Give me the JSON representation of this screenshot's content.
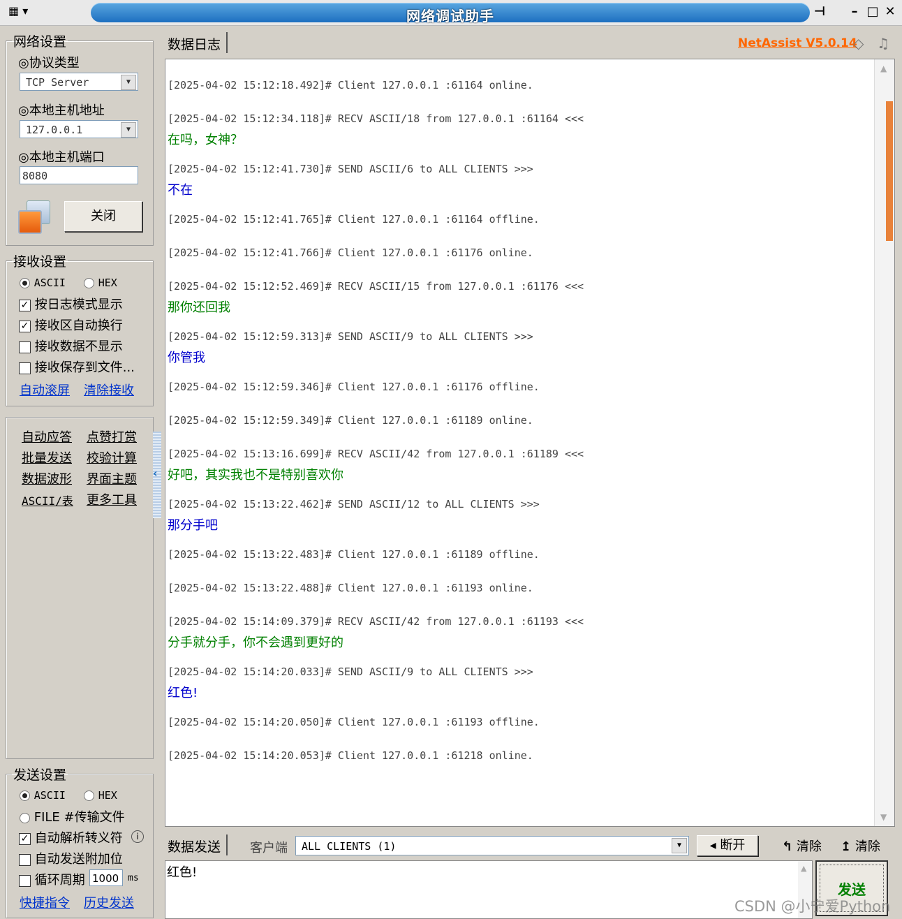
{
  "window": {
    "title": "网络调试助手"
  },
  "network": {
    "legend": "网络设置",
    "protocol_label": "◎协议类型",
    "protocol_value": "TCP Server",
    "host_label": "◎本地主机地址",
    "host_value": "127.0.0.1",
    "port_label": "◎本地主机端口",
    "port_value": "8080",
    "close_button": "关闭"
  },
  "receive": {
    "legend": "接收设置",
    "ascii": "ASCII",
    "hex": "HEX",
    "opt_log_mode": "按日志模式显示",
    "opt_auto_wrap": "接收区自动换行",
    "opt_hide": "接收数据不显示",
    "opt_save_file": "接收保存到文件...",
    "auto_scroll": "自动滚屏",
    "clear_recv": "清除接收"
  },
  "tools": [
    [
      "自动应答",
      "点赞打赏"
    ],
    [
      "批量发送",
      "校验计算"
    ],
    [
      "数据波形",
      "界面主题"
    ],
    [
      "ASCII/表",
      "更多工具"
    ]
  ],
  "send_settings": {
    "legend": "发送设置",
    "ascii": "ASCII",
    "hex": "HEX",
    "file": "FILE #传输文件",
    "opt_escape": "自动解析转义符",
    "opt_append": "自动发送附加位",
    "opt_cycle": "循环周期",
    "cycle_value": "1000",
    "cycle_unit": "ms",
    "shortcuts": "快捷指令",
    "history": "历史发送"
  },
  "log_panel": {
    "tab": "数据日志",
    "brand": "NetAssist V5.0.14",
    "entries": [
      {
        "header": "[2025-04-02 15:12:18.492]# Client 127.0.0.1 :61164 online.",
        "message": "",
        "kind": ""
      },
      {
        "header": "[2025-04-02 15:12:34.118]# RECV ASCII/18 from 127.0.0.1 :61164 <<<",
        "message": "在吗，女神？",
        "kind": "recv"
      },
      {
        "header": "[2025-04-02 15:12:41.730]# SEND ASCII/6 to ALL CLIENTS >>>",
        "message": "不在",
        "kind": "send"
      },
      {
        "header": "[2025-04-02 15:12:41.765]# Client 127.0.0.1 :61164 offline.",
        "message": "",
        "kind": ""
      },
      {
        "header": "[2025-04-02 15:12:41.766]# Client 127.0.0.1 :61176 online.",
        "message": "",
        "kind": ""
      },
      {
        "header": "[2025-04-02 15:12:52.469]# RECV ASCII/15 from 127.0.0.1 :61176 <<<",
        "message": "那你还回我",
        "kind": "recv"
      },
      {
        "header": "[2025-04-02 15:12:59.313]# SEND ASCII/9 to ALL CLIENTS >>>",
        "message": "你管我",
        "kind": "send"
      },
      {
        "header": "[2025-04-02 15:12:59.346]# Client 127.0.0.1 :61176 offline.",
        "message": "",
        "kind": ""
      },
      {
        "header": "[2025-04-02 15:12:59.349]# Client 127.0.0.1 :61189 online.",
        "message": "",
        "kind": ""
      },
      {
        "header": "[2025-04-02 15:13:16.699]# RECV ASCII/42 from 127.0.0.1 :61189 <<<",
        "message": "好吧，其实我也不是特别喜欢你",
        "kind": "recv"
      },
      {
        "header": "[2025-04-02 15:13:22.462]# SEND ASCII/12 to ALL CLIENTS >>>",
        "message": "那分手吧",
        "kind": "send"
      },
      {
        "header": "[2025-04-02 15:13:22.483]# Client 127.0.0.1 :61189 offline.",
        "message": "",
        "kind": ""
      },
      {
        "header": "[2025-04-02 15:13:22.488]# Client 127.0.0.1 :61193 online.",
        "message": "",
        "kind": ""
      },
      {
        "header": "[2025-04-02 15:14:09.379]# RECV ASCII/42 from 127.0.0.1 :61193 <<<",
        "message": "分手就分手，你不会遇到更好的",
        "kind": "recv"
      },
      {
        "header": "[2025-04-02 15:14:20.033]# SEND ASCII/9 to ALL CLIENTS >>>",
        "message": "红色!",
        "kind": "send"
      },
      {
        "header": "[2025-04-02 15:14:20.050]# Client 127.0.0.1 :61193 offline.",
        "message": "",
        "kind": ""
      },
      {
        "header": "[2025-04-02 15:14:20.053]# Client 127.0.0.1 :61218 online.",
        "message": "",
        "kind": ""
      }
    ]
  },
  "send_panel": {
    "tab": "数据发送",
    "client_label": "客户端",
    "client_value": "ALL CLIENTS (1)",
    "disconnect": "断开",
    "clear1": "清除",
    "clear2": "清除",
    "input_value": "红色!",
    "send_button": "发送"
  },
  "watermark": "CSDN @小宁爱Python",
  "colors": {
    "title_blue": "#1d6fc0",
    "recv": "#008000",
    "send": "#0000cc",
    "brand": "#ff6600",
    "link": "#0033cc"
  }
}
